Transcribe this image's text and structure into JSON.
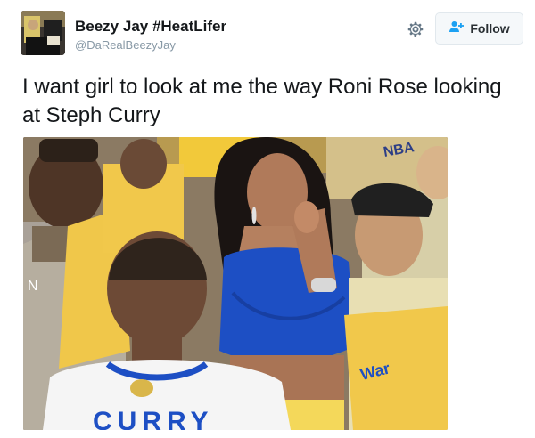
{
  "user": {
    "display_name": "Beezy Jay #HeatLifer",
    "handle": "@DaRealBeezyJay"
  },
  "actions": {
    "follow_label": "Follow",
    "settings_icon": "gear-icon",
    "follow_icon": "add-user-icon"
  },
  "tweet": {
    "text": "I want girl to look at me the way Roni Rose looking at Steph Curry"
  },
  "media": {
    "jersey_back_text": "CURRY",
    "shirt_text": "War",
    "banner_text": "NBA",
    "left_shirt_text": "N"
  },
  "colors": {
    "accent": "#1da1f2",
    "warriors_yellow": "#f7c72a",
    "warriors_blue": "#1d4fc4"
  }
}
